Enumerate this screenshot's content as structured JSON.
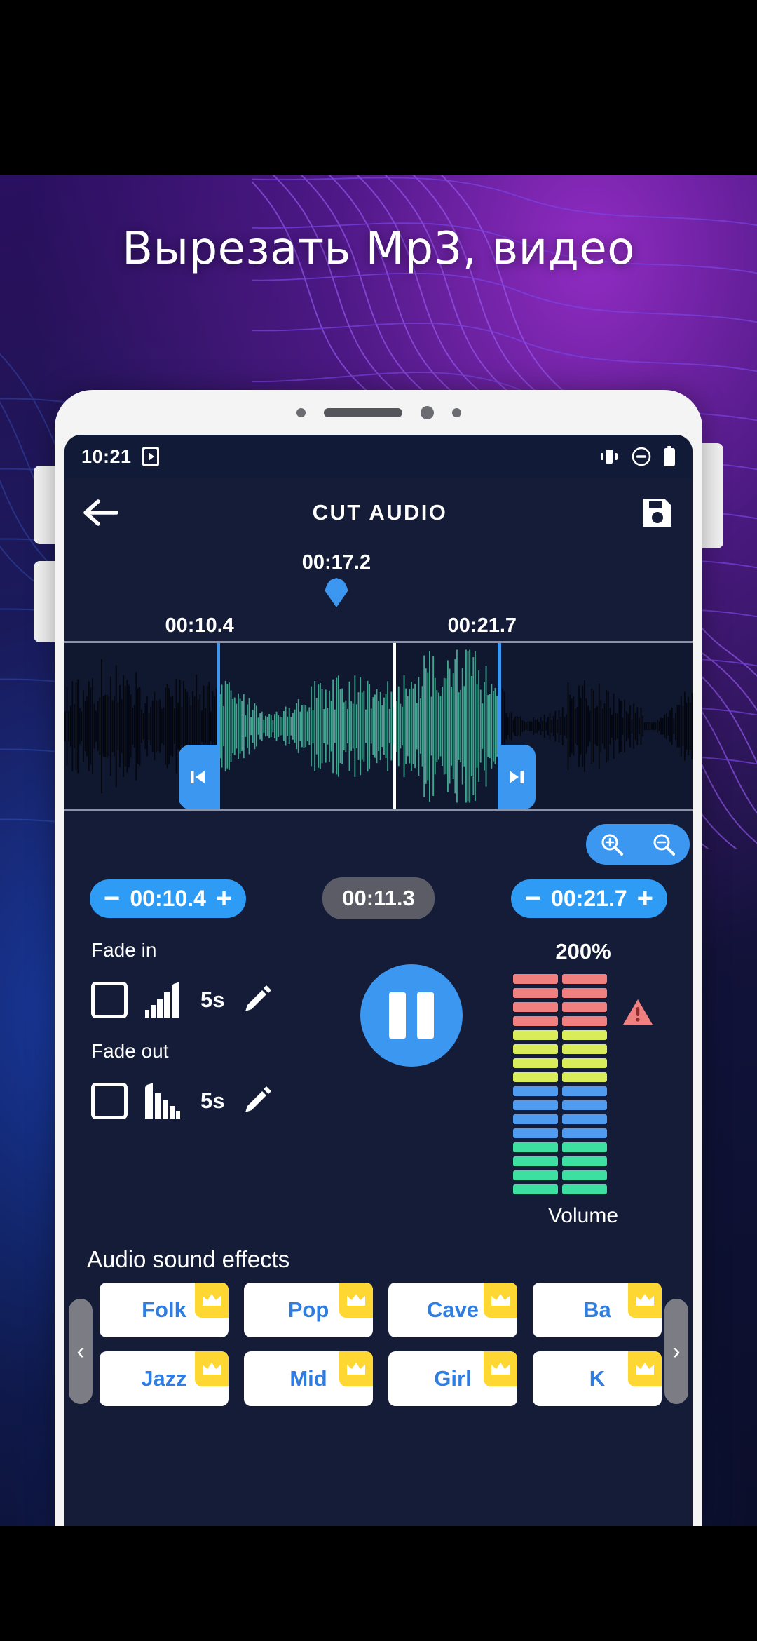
{
  "promo": {
    "title": "Вырезать Mp3, видео"
  },
  "phone": {
    "bezel": {
      "sensor_left": "sensor-dot",
      "speaker": "earpiece-speaker",
      "camera": "front-camera",
      "sensor_right": "proximity-sensor"
    },
    "side_buttons": [
      "volume-up",
      "volume-down",
      "power"
    ]
  },
  "status_bar": {
    "time": "10:21",
    "left_icons": [
      "media-notification-icon"
    ],
    "right_icons": [
      "vibrate-icon",
      "do-not-disturb-icon",
      "battery-icon"
    ]
  },
  "app_bar": {
    "back_icon": "back-arrow-icon",
    "title": "CUT AUDIO",
    "save_icon": "save-floppy-icon"
  },
  "editor": {
    "playhead_time": "00:17.2",
    "segment_start_label": "00:10.4",
    "segment_end_label": "00:21.7",
    "start_grip_icon": "skip-previous-icon",
    "end_grip_icon": "skip-next-icon",
    "zoom_in_icon": "zoom-in-icon",
    "zoom_out_icon": "zoom-out-icon"
  },
  "time_controls": {
    "start": {
      "minus": "−",
      "value": "00:10.4",
      "plus": "+"
    },
    "duration": "00:11.3",
    "end": {
      "minus": "−",
      "value": "00:21.7",
      "plus": "+"
    }
  },
  "fade": {
    "in": {
      "label": "Fade in",
      "checkbox": "unchecked",
      "icon": "fade-in-bars-icon",
      "seconds": "5s",
      "edit_icon": "pencil-icon"
    },
    "out": {
      "label": "Fade out",
      "checkbox": "unchecked",
      "icon": "fade-out-bars-icon",
      "seconds": "5s",
      "edit_icon": "pencil-icon"
    }
  },
  "player": {
    "state": "playing",
    "button_icon": "pause-icon"
  },
  "volume": {
    "percent": "200%",
    "label": "Volume",
    "warning_icon": "warning-triangle-icon",
    "rows": 16,
    "columns": 2,
    "band_colors": [
      "#f08080",
      "#d9ec5a",
      "#4f9bf0",
      "#3ee0a2"
    ],
    "band_sizes": [
      4,
      4,
      4,
      4
    ]
  },
  "sound_effects": {
    "title": "Audio sound effects",
    "prev_icon": "chevron-left-icon",
    "next_icon": "chevron-right-icon",
    "crown_icon": "crown-premium-icon",
    "rows": [
      [
        {
          "label": "Folk",
          "premium": true
        },
        {
          "label": "Pop",
          "premium": true
        },
        {
          "label": "Cave",
          "premium": true
        },
        {
          "label": "Ba",
          "premium": true
        }
      ],
      [
        {
          "label": "Jazz",
          "premium": true
        },
        {
          "label": "Mid",
          "premium": true
        },
        {
          "label": "Girl",
          "premium": true
        },
        {
          "label": "K",
          "premium": true
        }
      ]
    ]
  },
  "colors": {
    "accent_blue": "#3c97f0",
    "screen_bg": "#141c38",
    "wave_selected": "#3fa58f",
    "wave_unselected": "#05070f",
    "crown_yellow": "#ffd733"
  }
}
